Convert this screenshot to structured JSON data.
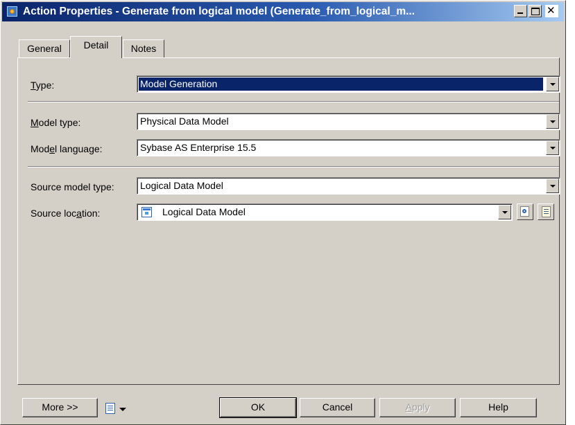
{
  "window": {
    "title": "Action Properties - Generate from logical model (Generate_from_logical_m...",
    "title_bar_color": "#0a246a"
  },
  "tabs": [
    {
      "label": "General",
      "selected": false
    },
    {
      "label": "Detail",
      "selected": true
    },
    {
      "label": "Notes",
      "selected": false
    }
  ],
  "form": {
    "type": {
      "label_pre": "",
      "label_acc": "T",
      "label_post": "ype:",
      "value": "Model Generation"
    },
    "model_type": {
      "label_pre": "",
      "label_acc": "M",
      "label_post": "odel type:",
      "value": "Physical Data Model"
    },
    "model_language": {
      "label_pre": "Mod",
      "label_acc": "e",
      "label_post": "l language:",
      "value": "Sybase AS Enterprise 15.5"
    },
    "source_model_type": {
      "label_pre": "Source model type:",
      "label_acc": "",
      "label_post": "",
      "value": "Logical Data Model"
    },
    "source_location": {
      "label_pre": "Source loc",
      "label_acc": "a",
      "label_post": "tion:",
      "value": "Logical Data Model",
      "icon": "logical-model-icon"
    }
  },
  "buttons": {
    "more": "More >>",
    "ok": "OK",
    "cancel": "Cancel",
    "apply_acc": "A",
    "apply_rest": "pply",
    "help": "Help"
  },
  "icons": {
    "properties_menu": "properties-list-icon",
    "find": "find-object-icon",
    "properties": "properties-icon"
  },
  "colors": {
    "dialog_bg": "#d4d0c8",
    "selection": "#0a246a"
  }
}
